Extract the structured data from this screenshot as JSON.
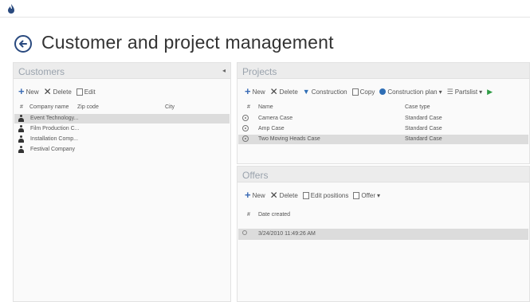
{
  "header": {
    "title": "Customer and project management"
  },
  "customers": {
    "title": "Customers",
    "toolbar": {
      "new": "New",
      "delete": "Delete",
      "edit": "Edit"
    },
    "columns": {
      "num": "#",
      "company": "Company name",
      "zip": "Zip code",
      "city": "City"
    },
    "rows": [
      {
        "company": "Event Technology...",
        "selected": true
      },
      {
        "company": "Film Production C...",
        "selected": false
      },
      {
        "company": "Installation Comp...",
        "selected": false
      },
      {
        "company": "Festival Company",
        "selected": false
      }
    ]
  },
  "projects": {
    "title": "Projects",
    "toolbar": {
      "new": "New",
      "delete": "Delete",
      "construction": "Construction",
      "copy": "Copy",
      "construction_plan": "Construction plan",
      "partslist": "Partslist"
    },
    "columns": {
      "num": "#",
      "name": "Name",
      "case_type": "Case type"
    },
    "rows": [
      {
        "name": "Camera Case",
        "case_type": "Standard Case",
        "selected": false
      },
      {
        "name": "Amp Case",
        "case_type": "Standard Case",
        "selected": false
      },
      {
        "name": "Two Moving Heads Case",
        "case_type": "Standard Case",
        "selected": true
      }
    ]
  },
  "offers": {
    "title": "Offers",
    "toolbar": {
      "new": "New",
      "delete": "Delete",
      "edit_positions": "Edit positions",
      "offer": "Offer"
    },
    "columns": {
      "num": "#",
      "date_created": "Date created"
    },
    "rows": [
      {
        "date": "3/24/2010 11:49:26 AM",
        "selected": true
      }
    ]
  },
  "icons": {
    "back": "back-arrow-icon",
    "app": "app-logo-icon"
  },
  "colors": {
    "accent": "#2a4a7f",
    "selection": "#dcdcdc",
    "panel_header": "#ececec"
  }
}
